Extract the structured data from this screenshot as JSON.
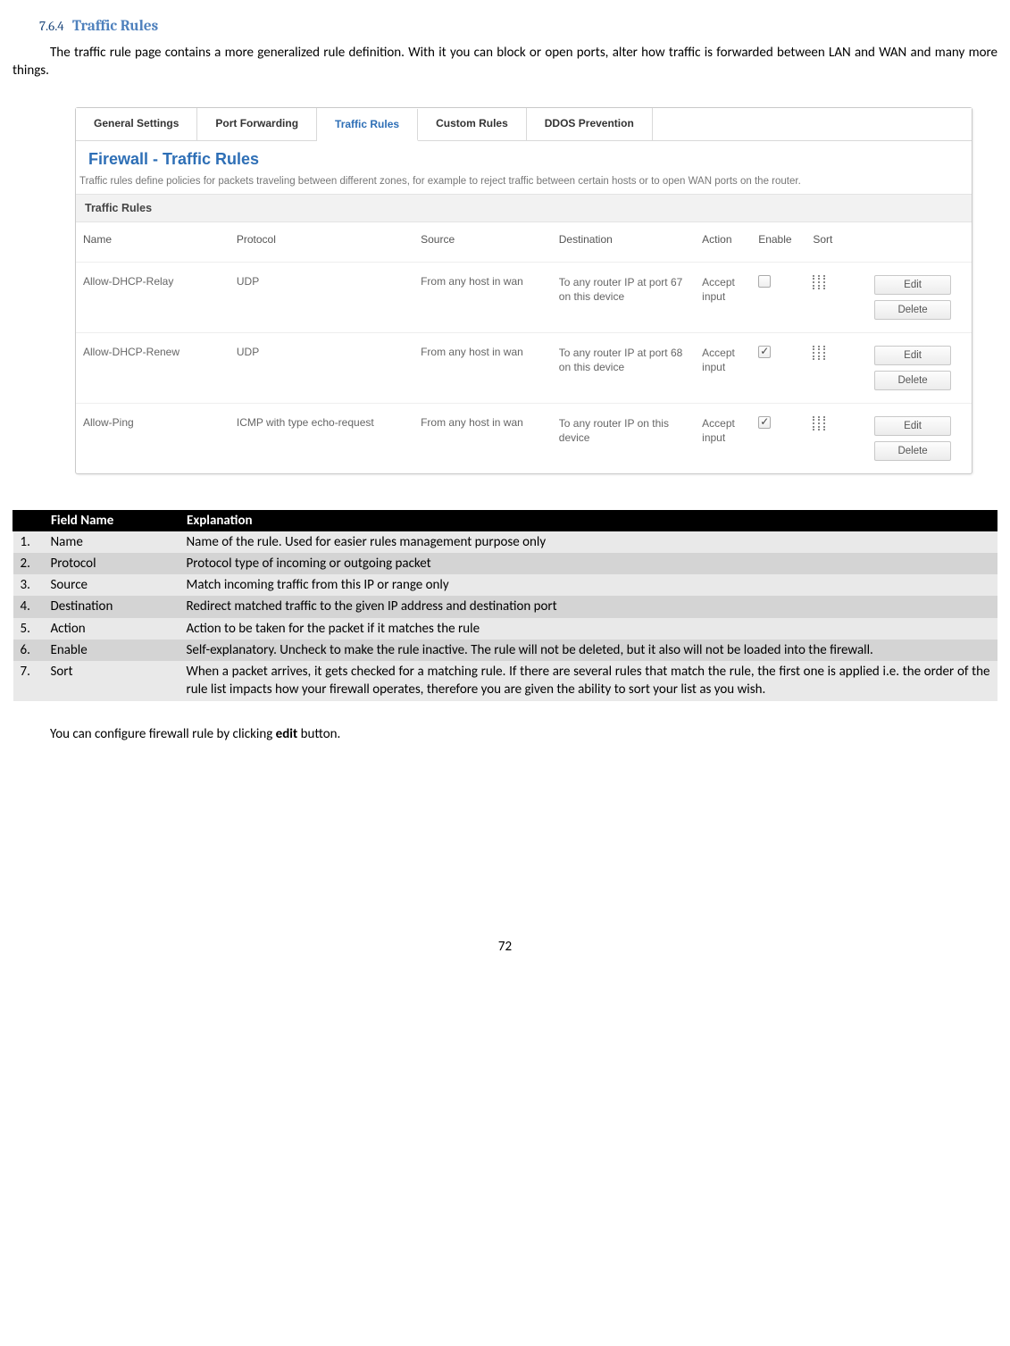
{
  "heading": {
    "number": "7.6.4",
    "title": "Traffic Rules"
  },
  "intro": "The traffic rule page contains a more generalized rule definition. With it you can block or open ports, alter how traffic is forwarded between LAN and WAN and many more things.",
  "ui": {
    "tabs": [
      {
        "label": "General Settings",
        "active": false
      },
      {
        "label": "Port Forwarding",
        "active": false
      },
      {
        "label": "Traffic Rules",
        "active": true
      },
      {
        "label": "Custom Rules",
        "active": false
      },
      {
        "label": "DDOS Prevention",
        "active": false
      }
    ],
    "panel_title": "Firewall - Traffic Rules",
    "panel_desc": "Traffic rules define policies for packets traveling between different zones, for example to reject traffic between certain hosts or to open WAN ports on the router.",
    "section_label": "Traffic Rules",
    "columns": {
      "name": "Name",
      "protocol": "Protocol",
      "source": "Source",
      "destination": "Destination",
      "action": "Action",
      "enable": "Enable",
      "sort": "Sort"
    },
    "buttons": {
      "edit": "Edit",
      "delete": "Delete"
    },
    "rows": [
      {
        "name": "Allow-DHCP-Relay",
        "protocol": "UDP",
        "source": "From any host in wan",
        "destination": "To any router IP at port 67 on this device",
        "action": "Accept input",
        "enabled": false
      },
      {
        "name": "Allow-DHCP-Renew",
        "protocol": "UDP",
        "source": "From any host in wan",
        "destination": "To any router IP at port 68 on this device",
        "action": "Accept input",
        "enabled": true
      },
      {
        "name": "Allow-Ping",
        "protocol": "ICMP with type echo-request",
        "source": "From any host in wan",
        "destination": "To any router IP on this device",
        "action": "Accept input",
        "enabled": true
      }
    ]
  },
  "field_table": {
    "headers": {
      "num": "",
      "name": "Field Name",
      "exp": "Explanation"
    },
    "rows": [
      {
        "n": "1.",
        "name": "Name",
        "exp": "Name of the rule. Used for easier rules management purpose only"
      },
      {
        "n": "2.",
        "name": "Protocol",
        "exp": "Protocol type of incoming or outgoing packet"
      },
      {
        "n": "3.",
        "name": "Source",
        "exp": "Match incoming traffic from this IP or range only"
      },
      {
        "n": "4.",
        "name": "Destination",
        "exp": "Redirect matched traffic to the given IP address and destination port"
      },
      {
        "n": "5.",
        "name": "Action",
        "exp": "Action to be taken for the packet if it matches the rule"
      },
      {
        "n": "6.",
        "name": "Enable",
        "exp": "Self-explanatory. Uncheck to make the rule inactive. The rule will not be deleted, but it also will not be loaded into the firewall."
      },
      {
        "n": "7.",
        "name": "Sort",
        "exp": "When a packet arrives, it gets checked for a matching rule. If there are several rules that match the rule, the first one is applied i.e. the order of the rule list impacts how your firewall operates, therefore you are given the ability to sort your list as you wish."
      }
    ]
  },
  "closing": {
    "pre": "You can configure firewall rule by clicking ",
    "bold": "edit",
    "post": " button."
  },
  "page_number": "72"
}
